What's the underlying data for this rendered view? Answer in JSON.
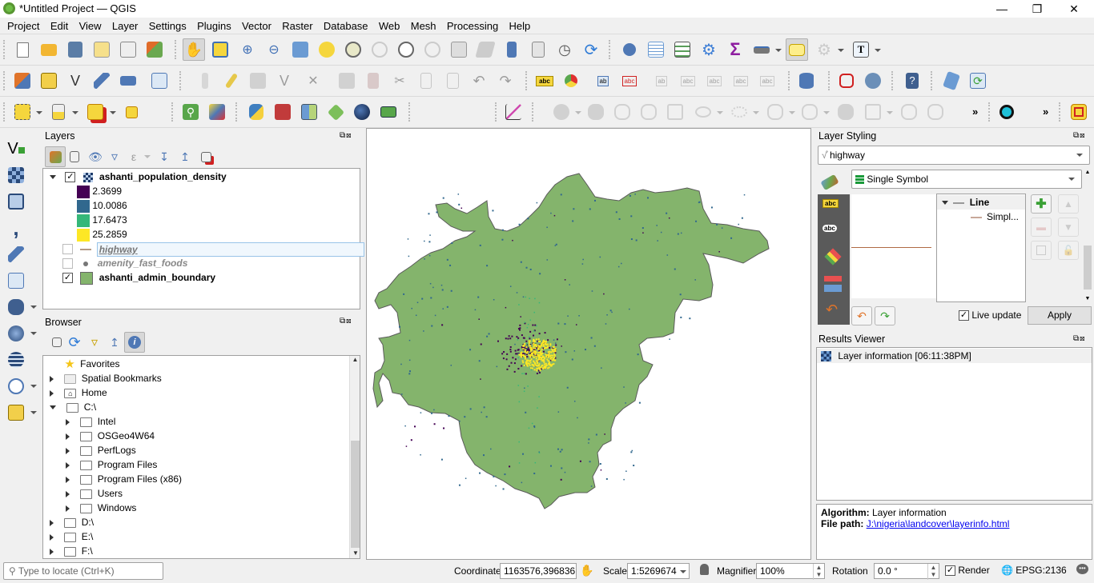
{
  "window": {
    "title": "*Untitled Project — QGIS",
    "controls": {
      "minimize": "—",
      "maximize": "❐",
      "close": "✕"
    }
  },
  "menubar": [
    "Project",
    "Edit",
    "View",
    "Layer",
    "Settings",
    "Plugins",
    "Vector",
    "Raster",
    "Database",
    "Web",
    "Mesh",
    "Processing",
    "Help"
  ],
  "toolbars": {
    "row1": [
      "new-project",
      "open-project",
      "save-project",
      "new-print-layout",
      "layout-manager",
      "style-manager",
      "pan-map",
      "pan-to-selection",
      "zoom-in",
      "zoom-out",
      "zoom-full",
      "zoom-to-selection",
      "zoom-to-layer",
      "zoom-native",
      "zoom-last",
      "zoom-next",
      "new-map-view",
      "new-3d-map-view",
      "new-spatial-bookmark",
      "show-spatial-bookmarks",
      "temporal-controller",
      "refresh",
      "identify-features",
      "open-attribute-table",
      "open-field-calculator",
      "toolbox",
      "statistical-summary",
      "measure-line",
      "map-tips",
      "select-by-location",
      "text-annotation"
    ],
    "row2": [
      "data-source-manager",
      "new-geopackage-layer",
      "new-shapefile-layer",
      "new-temporary-scratch-layer",
      "new-virtual-layer",
      "new-vector-layer",
      "current-edits",
      "toggle-editing",
      "save-layer-edits",
      "digitize",
      "vertex-tool",
      "modify-attributes",
      "delete-selected",
      "cut-features",
      "copy-features",
      "paste-features",
      "undo",
      "redo",
      "label-tool",
      "diagram-tool",
      "highlight-pinned-labels",
      "pin-unpin-labels",
      "show-hide-labels",
      "move-label",
      "rotate-label",
      "change-label",
      "change-label-properties",
      "db-manager",
      "geometry-checker",
      "metasearch",
      "qgis-help",
      "topology-checker",
      "refresh-attribute-table"
    ],
    "row3": [
      "select-features",
      "open-attribute-table-dropdown",
      "deselect-features",
      "select-by-value",
      "locator-search",
      "georeferencer",
      "python-console",
      "grass",
      "split-view",
      "layer-styling",
      "globe",
      "ascii-map",
      "profile-tool",
      "reshape-features",
      "offset-curve",
      "split-features",
      "split-parts",
      "merge-features",
      "merge-attributes",
      "rotate-point-symbols",
      "simplify",
      "add-ring",
      "add-part",
      "fill-ring",
      "delete-ring",
      "delete-part",
      "reshape",
      "more-overflow",
      "geocoder",
      "more-overflow-2",
      "road-graph"
    ]
  },
  "overflow_label": "»",
  "layers_panel": {
    "title": "Layers",
    "layers": [
      {
        "name": "ashanti_population_density",
        "checked": true,
        "expanded": true,
        "type": "raster",
        "style": "bold",
        "legend": [
          {
            "value": "2.3699",
            "color": "#440154"
          },
          {
            "value": "10.0086",
            "color": "#31688e"
          },
          {
            "value": "17.6473",
            "color": "#35b779"
          },
          {
            "value": "25.2859",
            "color": "#fde725"
          }
        ]
      },
      {
        "name": "highway",
        "checked": false,
        "type": "line",
        "style": "italic-selected",
        "color": "#b49a85"
      },
      {
        "name": "amenity_fast_foods",
        "checked": false,
        "type": "point",
        "style": "italic"
      },
      {
        "name": "ashanti_admin_boundary",
        "checked": true,
        "type": "polygon",
        "style": "bold",
        "color": "#84b46c"
      }
    ]
  },
  "browser_panel": {
    "title": "Browser",
    "items": [
      {
        "label": "Favorites",
        "icon": "star-icon",
        "level": 0,
        "expander": "none"
      },
      {
        "label": "Spatial Bookmarks",
        "icon": "bookmark-icon",
        "level": 0,
        "expander": "collapsed"
      },
      {
        "label": "Home",
        "icon": "home-icon",
        "level": 0,
        "expander": "collapsed"
      },
      {
        "label": "C:\\",
        "icon": "drive-icon",
        "level": 0,
        "expander": "expanded"
      },
      {
        "label": "Intel",
        "icon": "folder-icon",
        "level": 1,
        "expander": "collapsed"
      },
      {
        "label": "OSGeo4W64",
        "icon": "folder-icon",
        "level": 1,
        "expander": "collapsed"
      },
      {
        "label": "PerfLogs",
        "icon": "folder-icon",
        "level": 1,
        "expander": "collapsed"
      },
      {
        "label": "Program Files",
        "icon": "folder-icon",
        "level": 1,
        "expander": "collapsed"
      },
      {
        "label": "Program Files (x86)",
        "icon": "folder-icon",
        "level": 1,
        "expander": "collapsed"
      },
      {
        "label": "Users",
        "icon": "folder-icon",
        "level": 1,
        "expander": "collapsed"
      },
      {
        "label": "Windows",
        "icon": "folder-icon",
        "level": 1,
        "expander": "collapsed"
      },
      {
        "label": "D:\\",
        "icon": "folder-icon",
        "level": 0,
        "expander": "collapsed"
      },
      {
        "label": "E:\\",
        "icon": "folder-icon",
        "level": 0,
        "expander": "collapsed"
      },
      {
        "label": "F:\\",
        "icon": "folder-icon",
        "level": 0,
        "expander": "collapsed"
      }
    ]
  },
  "layer_styling": {
    "title": "Layer Styling",
    "layer_select": "highway",
    "renderer_select": "Single Symbol",
    "symbol_tree": {
      "root": "Line",
      "child": "Simpl..."
    },
    "line_color": "#b06a43",
    "live_update_label": "Live update",
    "live_update_checked": true,
    "apply_label": "Apply"
  },
  "results_viewer": {
    "title": "Results Viewer",
    "items": [
      "Layer information [06:11:38PM]"
    ],
    "algorithm_label": "Algorithm:",
    "algorithm_value": "Layer information",
    "filepath_label": "File path:",
    "filepath_value": "J:\\nigeria\\landcover\\layerinfo.html"
  },
  "map": {
    "boundary_fill": "#84b46c",
    "boundary_stroke": "#5a5a5a",
    "background": "#ffffff"
  },
  "statusbar": {
    "locator_placeholder": "Type to locate (Ctrl+K)",
    "coordinate_label": "Coordinate",
    "coordinate_value": "1163576,396836",
    "scale_label": "Scale",
    "scale_value": "1:5269674",
    "magnifier_label": "Magnifier",
    "magnifier_value": "100%",
    "rotation_label": "Rotation",
    "rotation_value": "0.0 °",
    "render_label": "Render",
    "render_checked": true,
    "crs_label": "EPSG:2136"
  }
}
